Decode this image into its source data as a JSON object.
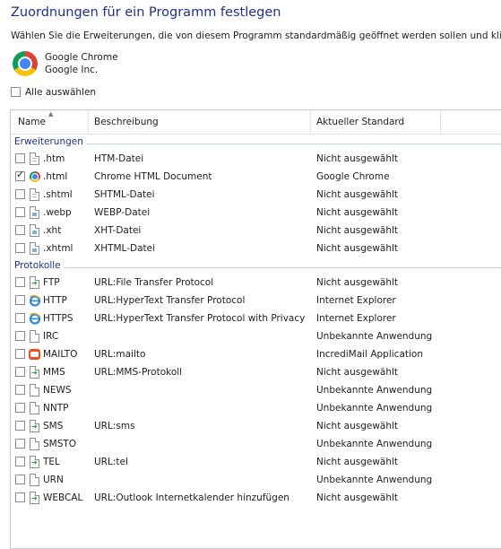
{
  "page": {
    "title": "Zuordnungen für ein Programm festlegen",
    "subtitle": "Wählen Sie die Erweiterungen, die von diesem Programm standardmäßig geöffnet werden sollen und klic"
  },
  "program": {
    "name": "Google Chrome",
    "vendor": "Google Inc.",
    "icon": "chrome-icon"
  },
  "select_all": {
    "label": "Alle auswählen",
    "checked": false
  },
  "columns": {
    "name": "Name",
    "description": "Beschreibung",
    "current_default": "Aktueller Standard"
  },
  "groups": [
    {
      "label": "Erweiterungen",
      "items": [
        {
          "name": ".htm",
          "description": "HTM-Datei",
          "current_default": "Nicht ausgewählt",
          "checked": false,
          "icon": "document-icon"
        },
        {
          "name": ".html",
          "description": "Chrome HTML Document",
          "current_default": "Google Chrome",
          "checked": true,
          "icon": "chrome-icon"
        },
        {
          "name": ".shtml",
          "description": "SHTML-Datei",
          "current_default": "Nicht ausgewählt",
          "checked": false,
          "icon": "document-icon"
        },
        {
          "name": ".webp",
          "description": "WEBP-Datei",
          "current_default": "Nicht ausgewählt",
          "checked": false,
          "icon": "image-document-icon"
        },
        {
          "name": ".xht",
          "description": "XHT-Datei",
          "current_default": "Nicht ausgewählt",
          "checked": false,
          "icon": "image-document-icon"
        },
        {
          "name": ".xhtml",
          "description": "XHTML-Datei",
          "current_default": "Nicht ausgewählt",
          "checked": false,
          "icon": "image-document-icon"
        }
      ]
    },
    {
      "label": "Protokolle",
      "items": [
        {
          "name": "FTP",
          "description": "URL:File Transfer Protocol",
          "current_default": "Nicht ausgewählt",
          "checked": false,
          "icon": "link-document-icon"
        },
        {
          "name": "HTTP",
          "description": "URL:HyperText Transfer Protocol",
          "current_default": "Internet Explorer",
          "checked": false,
          "icon": "internet-explorer-icon"
        },
        {
          "name": "HTTPS",
          "description": "URL:HyperText Transfer Protocol with Privacy",
          "current_default": "Internet Explorer",
          "checked": false,
          "icon": "internet-explorer-icon"
        },
        {
          "name": "IRC",
          "description": "",
          "current_default": "Unbekannte Anwendung",
          "checked": false,
          "icon": "blank-document-icon"
        },
        {
          "name": "MAILTO",
          "description": "URL:mailto",
          "current_default": "IncrediMail Application",
          "checked": false,
          "icon": "mail-icon"
        },
        {
          "name": "MMS",
          "description": "URL:MMS-Protokoll",
          "current_default": "Nicht ausgewählt",
          "checked": false,
          "icon": "link-document-icon"
        },
        {
          "name": "NEWS",
          "description": "",
          "current_default": "Unbekannte Anwendung",
          "checked": false,
          "icon": "blank-document-icon"
        },
        {
          "name": "NNTP",
          "description": "",
          "current_default": "Unbekannte Anwendung",
          "checked": false,
          "icon": "blank-document-icon"
        },
        {
          "name": "SMS",
          "description": "URL:sms",
          "current_default": "Nicht ausgewählt",
          "checked": false,
          "icon": "link-document-icon"
        },
        {
          "name": "SMSTO",
          "description": "",
          "current_default": "Unbekannte Anwendung",
          "checked": false,
          "icon": "blank-document-icon"
        },
        {
          "name": "TEL",
          "description": "URL:tel",
          "current_default": "Nicht ausgewählt",
          "checked": false,
          "icon": "link-document-icon"
        },
        {
          "name": "URN",
          "description": "",
          "current_default": "Unbekannte Anwendung",
          "checked": false,
          "icon": "blank-document-icon"
        },
        {
          "name": "WEBCAL",
          "description": "URL:Outlook Internetkalender hinzufügen",
          "current_default": "Nicht ausgewählt",
          "checked": false,
          "icon": "link-document-icon"
        }
      ]
    }
  ],
  "colors": {
    "title": "#1e3287",
    "group_label": "#1e3287",
    "text": "#1e1e1e"
  }
}
